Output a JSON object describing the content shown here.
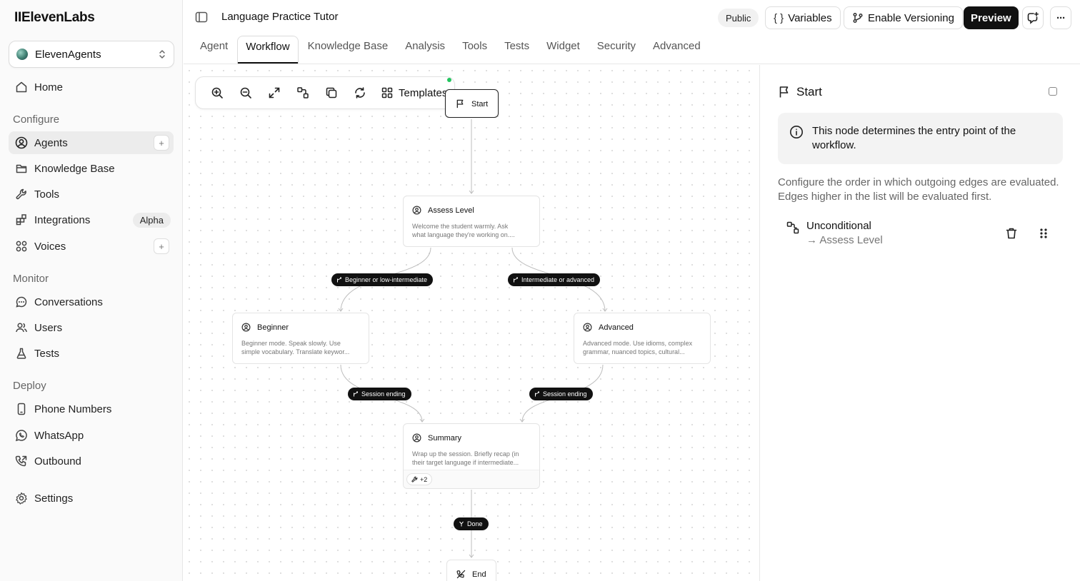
{
  "brand": {
    "logo": "IIElevenLabs"
  },
  "workspace": {
    "name": "ElevenAgents"
  },
  "sidebar": {
    "home": "Home",
    "sections": {
      "configure": "Configure",
      "monitor": "Monitor",
      "deploy": "Deploy"
    },
    "configure_items": [
      {
        "label": "Agents",
        "icon": "user-circle-icon",
        "active": true
      },
      {
        "label": "Knowledge Base",
        "icon": "folder-icon"
      },
      {
        "label": "Tools",
        "icon": "wrench-icon"
      },
      {
        "label": "Integrations",
        "icon": "puzzle-icon",
        "badge": "Alpha"
      },
      {
        "label": "Voices",
        "icon": "voices-icon"
      }
    ],
    "monitor_items": [
      {
        "label": "Conversations",
        "icon": "chat-icon"
      },
      {
        "label": "Users",
        "icon": "users-icon"
      },
      {
        "label": "Tests",
        "icon": "flask-icon"
      }
    ],
    "deploy_items": [
      {
        "label": "Phone Numbers",
        "icon": "phone-device-icon"
      },
      {
        "label": "WhatsApp",
        "icon": "whatsapp-icon"
      },
      {
        "label": "Outbound",
        "icon": "outbound-call-icon"
      }
    ],
    "settings": "Settings"
  },
  "header": {
    "title": "Language Practice Tutor",
    "public_label": "Public",
    "variables_label": "Variables",
    "variables_glyph": "{ }",
    "versioning_label": "Enable Versioning",
    "preview_label": "Preview",
    "more_glyph": "···"
  },
  "tabs": [
    {
      "label": "Agent"
    },
    {
      "label": "Workflow",
      "active": true
    },
    {
      "label": "Knowledge Base"
    },
    {
      "label": "Analysis"
    },
    {
      "label": "Tools"
    },
    {
      "label": "Tests"
    },
    {
      "label": "Widget"
    },
    {
      "label": "Security"
    },
    {
      "label": "Advanced"
    }
  ],
  "toolbar": {
    "templates_label": "Templates"
  },
  "workflow": {
    "start": {
      "label": "Start"
    },
    "assess": {
      "title": "Assess Level",
      "desc_line1": "Welcome the student warmly. Ask",
      "desc_line2": "what language they're working on...."
    },
    "beginner": {
      "title": "Beginner",
      "desc_line1": "Beginner mode. Speak slowly. Use",
      "desc_line2": "simple vocabulary. Translate keywor..."
    },
    "advanced": {
      "title": "Advanced",
      "desc_line1": "Advanced mode. Use idioms, complex",
      "desc_line2": "grammar, nuanced topics, cultural..."
    },
    "summary": {
      "title": "Summary",
      "desc_line1": "Wrap up the session. Briefly recap (in",
      "desc_line2": "their target language if intermediate...",
      "tools_chip": "+2"
    },
    "end": {
      "label": "End"
    },
    "edges": {
      "beginner": "Beginner or low-intermediate",
      "advanced": "Intermediate or advanced",
      "session_left": "Session ending",
      "session_right": "Session ending",
      "done": "Done"
    }
  },
  "panel": {
    "title": "Start",
    "info": "This node determines the entry point of the workflow.",
    "description": "Configure the order in which outgoing edges are evaluated. Edges higher in the list will be evaluated first.",
    "edge": {
      "name": "Unconditional",
      "target": "→ Assess Level"
    }
  }
}
